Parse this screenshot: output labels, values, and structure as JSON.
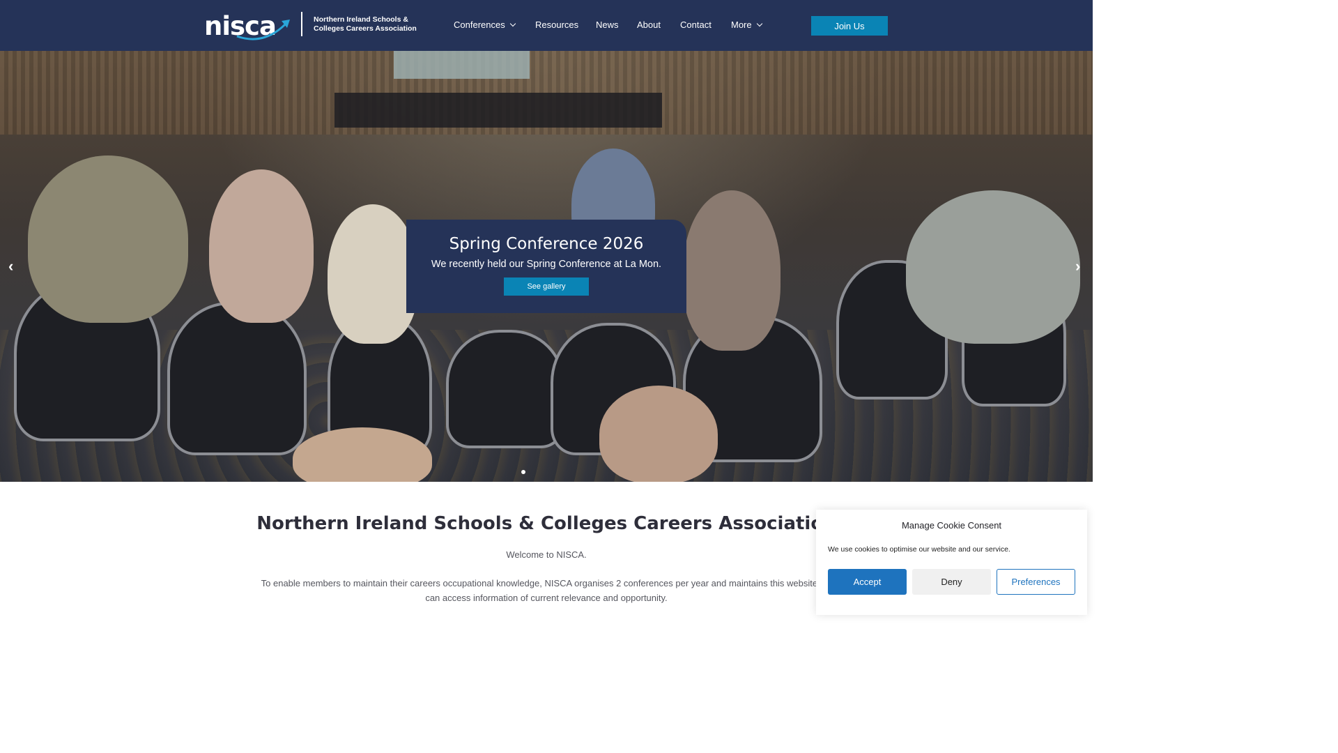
{
  "header": {
    "logo_word": "nisca",
    "logo_tagline_line1": "Northern Ireland Schools &",
    "logo_tagline_line2": "Colleges Careers Association",
    "nav": [
      {
        "label": "Conferences",
        "has_dropdown": true
      },
      {
        "label": "Resources",
        "has_dropdown": false
      },
      {
        "label": "News",
        "has_dropdown": false
      },
      {
        "label": "About",
        "has_dropdown": false
      },
      {
        "label": "Contact",
        "has_dropdown": false
      },
      {
        "label": "More",
        "has_dropdown": true
      }
    ],
    "join_label": "Join Us"
  },
  "hero": {
    "slide_title": "Spring Conference 2026",
    "slide_subtitle": "We recently held our Spring Conference at La Mon.",
    "slide_button": "See gallery",
    "prev_icon": "chevron-left-icon",
    "next_icon": "chevron-right-icon"
  },
  "main": {
    "title": "Northern Ireland Schools & Colleges Careers Association",
    "welcome": "Welcome to NISCA.",
    "intro_line1": "To enable members to maintain their careers occupational knowledge, NISCA organises 2 conferences per year and maintains this website wh",
    "intro_line2": "can access information of current relevance and opportunity."
  },
  "cookie": {
    "title": "Manage Cookie Consent",
    "text": "We use cookies to optimise our website and our service.",
    "accept": "Accept",
    "deny": "Deny",
    "preferences": "Preferences"
  },
  "colors": {
    "header_bg": "#253358",
    "accent": "#0a84b5",
    "cookie_accent": "#1e73be"
  }
}
